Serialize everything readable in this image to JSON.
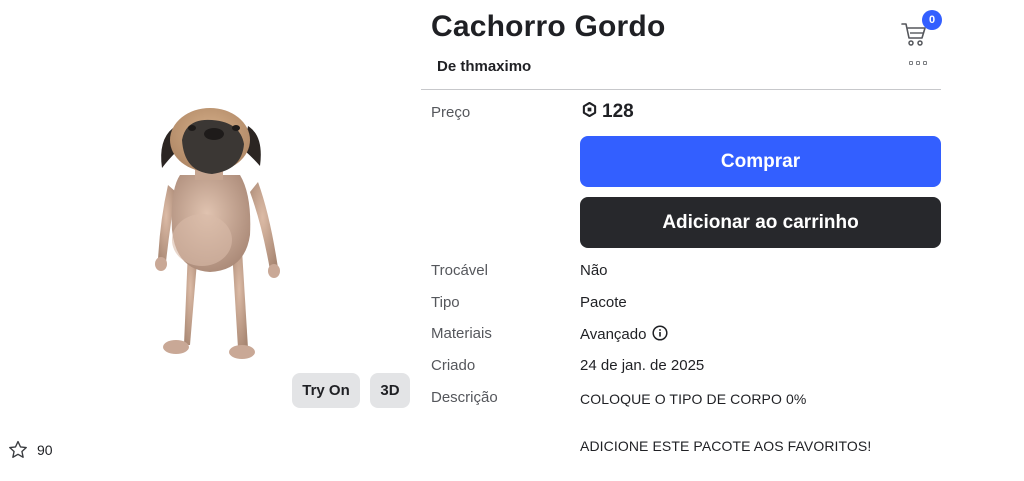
{
  "item": {
    "title": "Cachorro Gordo",
    "creator": "De thmaximo"
  },
  "cart": {
    "count": "0"
  },
  "preview": {
    "try_on_label": "Try On",
    "three_d_label": "3D"
  },
  "favorites": {
    "count": "90"
  },
  "details": {
    "price_label": "Preço",
    "price_value": "128",
    "buy_label": "Comprar",
    "add_to_cart_label": "Adicionar ao carrinho",
    "tradable_label": "Trocável",
    "tradable_value": "Não",
    "type_label": "Tipo",
    "type_value": "Pacote",
    "materials_label": "Materiais",
    "materials_value": "Avançado",
    "created_label": "Criado",
    "created_value": "24 de jan. de 2025",
    "description_label": "Descrição",
    "description_lines": [
      "COLOQUE O TIPO DE CORPO 0%",
      "ADICIONE ESTE PACOTE AOS FAVORITOS!"
    ]
  },
  "colors": {
    "accent": "#335fff",
    "dark_button": "#27282c",
    "text_primary": "#1f2024",
    "text_secondary": "#55575c"
  }
}
